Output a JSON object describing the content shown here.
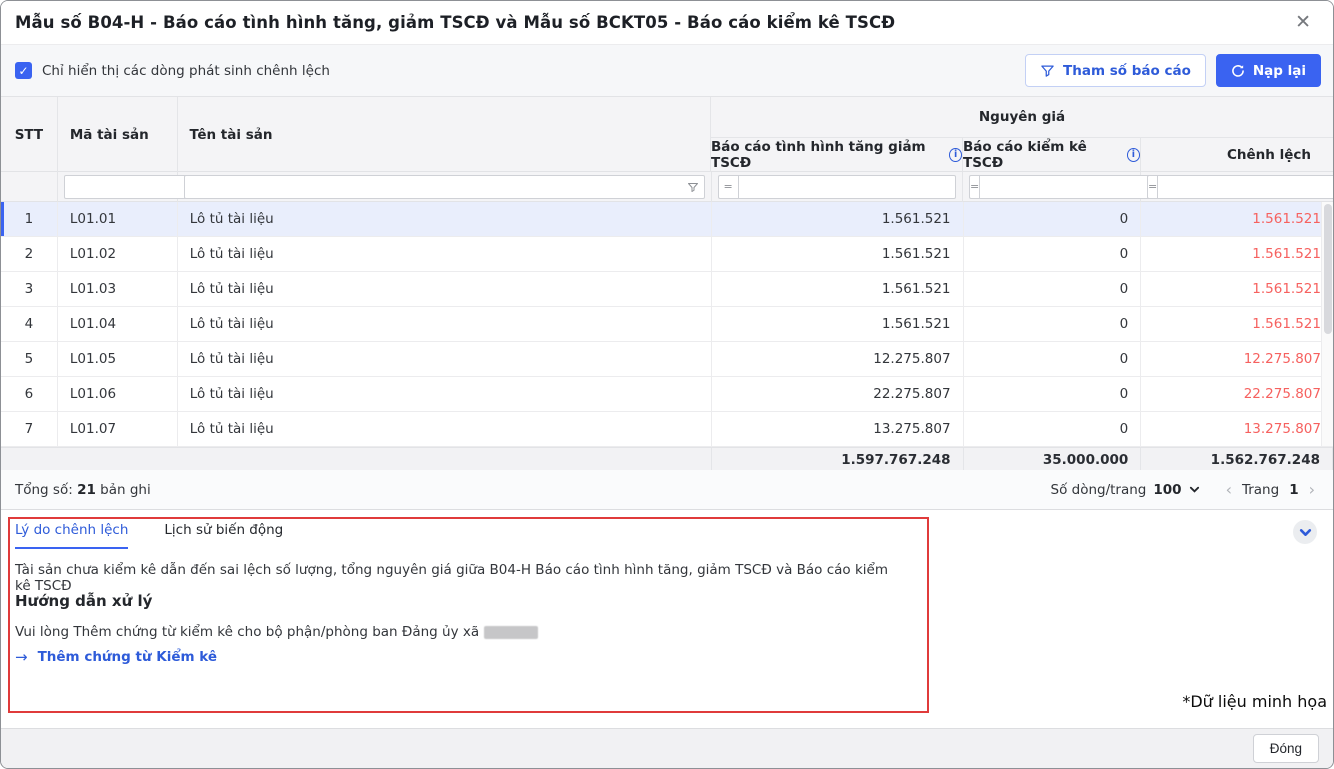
{
  "dialog": {
    "title": "Mẫu số B04-H - Báo cáo tình hình tăng, giảm TSCĐ và Mẫu số BCKT05 - Báo cáo kiểm kê TSCĐ",
    "close_glyph": "✕"
  },
  "toolbar": {
    "checkbox_label": "Chỉ hiển thị các dòng phát sinh chênh lệch",
    "checkbox_checked": true,
    "checkbox_glyph": "✓",
    "param_button": "Tham số báo cáo",
    "reload_button": "Nạp lại"
  },
  "table": {
    "group_header": "Nguyên giá",
    "columns": {
      "stt": "STT",
      "code": "Mã tài sản",
      "name": "Tên tài sản"
    },
    "sub_columns": [
      "Báo cáo tình hình tăng giảm TSCĐ",
      "Báo cáo kiểm kê TSCĐ",
      "Chênh lệch"
    ],
    "info_glyph": "i",
    "filter_equals": "=",
    "rows": [
      {
        "stt": "1",
        "code": "L01.01",
        "name": "Lô tủ tài liệu",
        "increase": "1.561.521",
        "inventory": "0",
        "diff": "1.561.521"
      },
      {
        "stt": "2",
        "code": "L01.02",
        "name": "Lô tủ tài liệu",
        "increase": "1.561.521",
        "inventory": "0",
        "diff": "1.561.521"
      },
      {
        "stt": "3",
        "code": "L01.03",
        "name": "Lô tủ tài liệu",
        "increase": "1.561.521",
        "inventory": "0",
        "diff": "1.561.521"
      },
      {
        "stt": "4",
        "code": "L01.04",
        "name": "Lô tủ tài liệu",
        "increase": "1.561.521",
        "inventory": "0",
        "diff": "1.561.521"
      },
      {
        "stt": "5",
        "code": "L01.05",
        "name": "Lô tủ tài liệu",
        "increase": "12.275.807",
        "inventory": "0",
        "diff": "12.275.807"
      },
      {
        "stt": "6",
        "code": "L01.06",
        "name": "Lô tủ tài liệu",
        "increase": "22.275.807",
        "inventory": "0",
        "diff": "22.275.807"
      },
      {
        "stt": "7",
        "code": "L01.07",
        "name": "Lô tủ tài liệu",
        "increase": "13.275.807",
        "inventory": "0",
        "diff": "13.275.807"
      }
    ],
    "selected_row_index": 0,
    "totals": {
      "increase": "1.597.767.248",
      "inventory": "35.000.000",
      "diff": "1.562.767.248"
    }
  },
  "pagination": {
    "total_prefix": "Tổng số:",
    "total_count": "21",
    "total_suffix": "bản ghi",
    "rows_per_page_label": "Số dòng/trang",
    "rows_per_page": "100",
    "prev_glyph": "‹",
    "page_label": "Trang",
    "page": "1",
    "next_glyph": "›"
  },
  "detail_panel": {
    "tabs": [
      {
        "label": "Lý do chênh lệch"
      },
      {
        "label": "Lịch sử biến động"
      }
    ],
    "active_tab": "Lý do chênh lệch",
    "reason": "Tài sản chưa kiểm kê dẫn đến sai lệch số lượng, tổng nguyên giá giữa B04-H Báo cáo tình hình tăng, giảm TSCĐ và Báo cáo kiểm kê TSCĐ",
    "guide_title": "Hướng dẫn xử lý",
    "guide_text": "Vui lòng Thêm chứng từ kiểm kê cho bộ phận/phòng ban Đảng ủy xã",
    "link_arrow": "→",
    "link_label": "Thêm chứng từ Kiểm kê"
  },
  "watermark": "*Dữ liệu minh họa",
  "footer": {
    "close_button": "Đóng"
  },
  "colors": {
    "accent_blue": "#3a63f1",
    "text_blue": "#2e5bd9",
    "diff_red": "#f6615f",
    "annotation_red": "#e03b3b"
  }
}
